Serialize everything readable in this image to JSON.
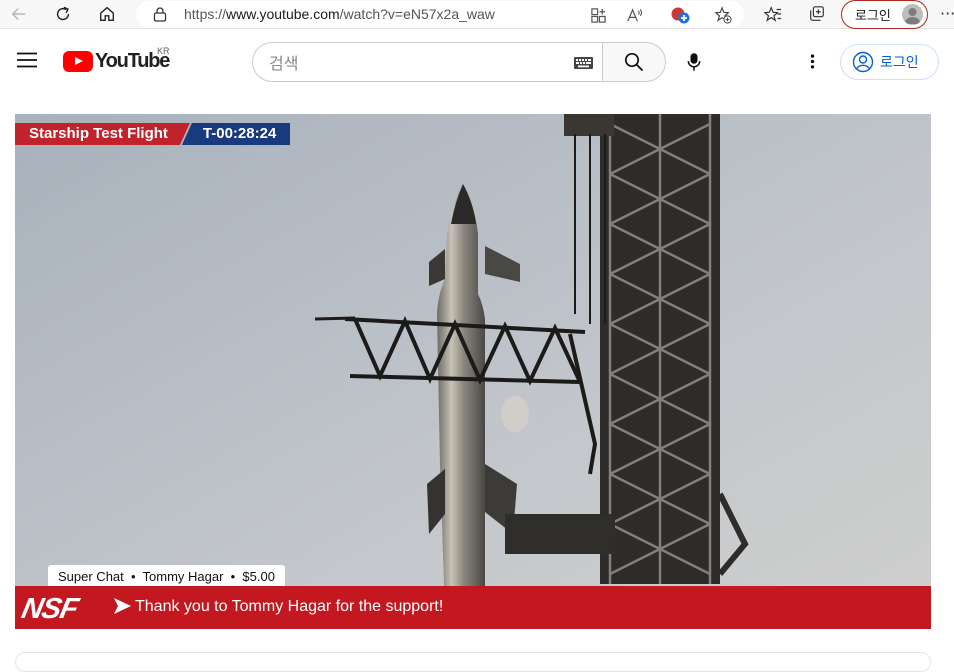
{
  "browser": {
    "url_prefix": "https://",
    "url_host": "www.youtube.com",
    "url_path": "/watch?v=eN57x2a_waw",
    "login_label": "로그인",
    "more_label": "···",
    "icons": [
      "back-icon",
      "refresh-icon",
      "home-icon",
      "lock-icon",
      "apps-icon",
      "read-aloud-icon",
      "extension-icon",
      "favorite-add-icon",
      "favorites-icon",
      "collections-icon",
      "profile-icon"
    ]
  },
  "header": {
    "logo_text": "YouTube",
    "country_code": "KR",
    "search_placeholder": "검색",
    "login_label": "로그인",
    "icons": [
      "menu-icon",
      "keyboard-icon",
      "search-icon",
      "mic-icon",
      "more-vert-icon",
      "account-circle-icon"
    ]
  },
  "player": {
    "banner_title": "Starship Test Flight",
    "banner_countdown": "T-00:28:24",
    "superchat_tag": "Super Chat  •  Tommy Hagar  •  $5.00",
    "nsf_logo": "NSF",
    "nsf_message": "Thank you to Tommy Hagar for the support!",
    "colors": {
      "banner_red": "#c0232b",
      "banner_blue": "#1a3a80",
      "nsf_red": "#c41820"
    }
  }
}
